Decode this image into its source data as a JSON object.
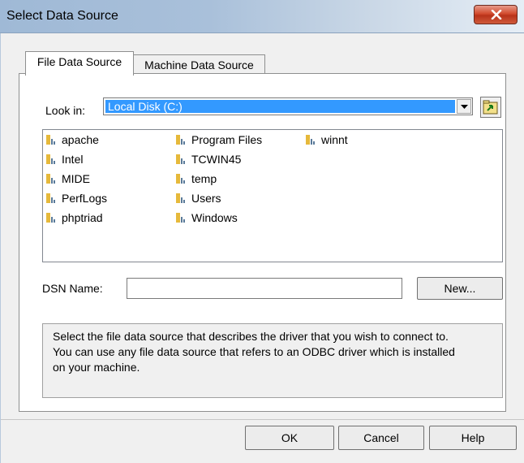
{
  "window": {
    "title": "Select Data Source",
    "close_icon": "close-icon"
  },
  "tabs": [
    {
      "label": "File Data Source",
      "active": true
    },
    {
      "label": "Machine Data Source",
      "active": false
    }
  ],
  "look_in": {
    "label": "Look in:",
    "value": "Local Disk (C:)",
    "up_folder_icon": "up-folder-icon"
  },
  "files": [
    {
      "name": "apache",
      "icon": "folder-icon"
    },
    {
      "name": "Intel",
      "icon": "folder-icon"
    },
    {
      "name": "MIDE",
      "icon": "folder-icon"
    },
    {
      "name": "PerfLogs",
      "icon": "folder-icon"
    },
    {
      "name": "phptriad",
      "icon": "folder-icon"
    },
    {
      "name": "Program Files",
      "icon": "folder-icon"
    },
    {
      "name": "TCWIN45",
      "icon": "folder-icon"
    },
    {
      "name": "temp",
      "icon": "folder-icon"
    },
    {
      "name": "Users",
      "icon": "folder-icon"
    },
    {
      "name": "Windows",
      "icon": "folder-icon"
    },
    {
      "name": "winnt",
      "icon": "folder-icon"
    }
  ],
  "dsn": {
    "label": "DSN Name:",
    "value": "",
    "new_button": "New..."
  },
  "info": {
    "line1": "Select the file data source that describes the driver that you wish to connect to.",
    "line2": "You can use any file data source that refers to an ODBC driver which is installed",
    "line3": "on your machine."
  },
  "buttons": {
    "ok": "OK",
    "cancel": "Cancel",
    "help": "Help"
  },
  "colors": {
    "selection": "#3399ff",
    "title_gradient_start": "#9fb9d6",
    "close_button": "#d24b2e"
  }
}
